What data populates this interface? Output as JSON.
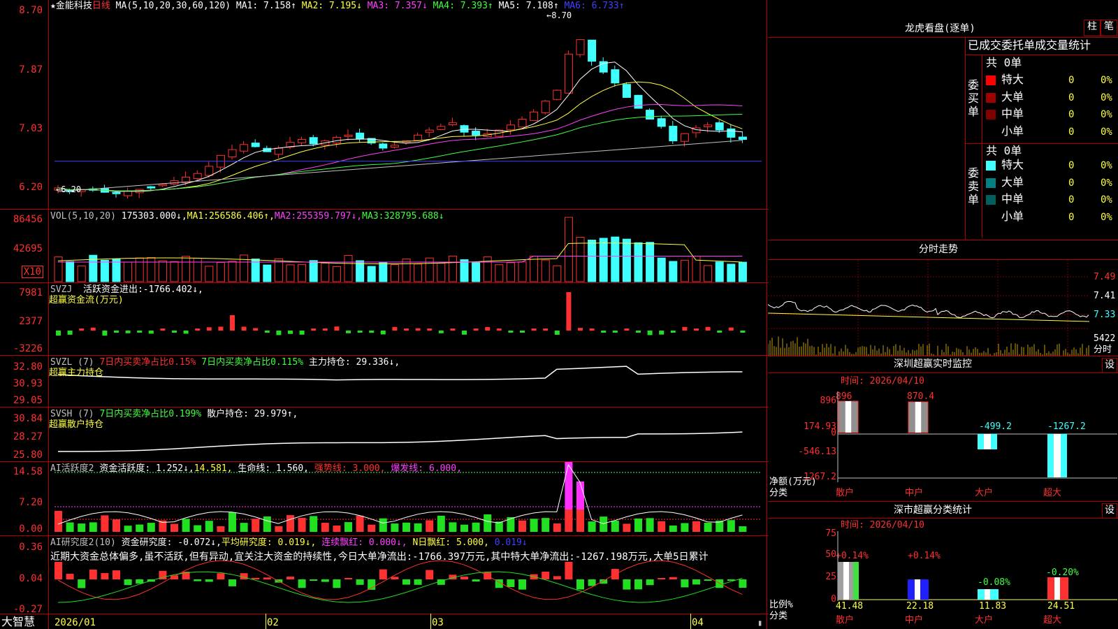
{
  "main_chart": {
    "title": "★金能科技",
    "period": "日线",
    "ma_params": "MA(5,10,20,30,60,120)",
    "ma_values": [
      {
        "label": "MA1:",
        "value": "7.158↑",
        "color": "#ffffff"
      },
      {
        "label": "MA2:",
        "value": "7.195↓",
        "color": "#ffff40"
      },
      {
        "label": "MA3:",
        "value": "7.357↓",
        "color": "#ff40ff"
      },
      {
        "label": "MA4:",
        "value": "7.393↑",
        "color": "#40ff40"
      },
      {
        "label": "MA5:",
        "value": "7.108↑",
        "color": "#ffffff"
      },
      {
        "label": "MA6:",
        "value": "6.733↑",
        "color": "#4040ff"
      }
    ],
    "y_ticks": [
      "8.70",
      "7.87",
      "7.03",
      "6.20"
    ],
    "high_label": "8.70",
    "low_label": "6.20"
  },
  "volume": {
    "params": "VOL(5,10,20)",
    "value": "175303.000↓,",
    "ma1": "256586.406↑,",
    "ma2": "255359.797↓,",
    "ma3": "328795.688↓",
    "y_ticks": [
      "86456",
      "42695"
    ],
    "unit": "X10"
  },
  "svzj": {
    "label": "SVZJ",
    "active_flow": "活跃资金进出:-1766.402↓,",
    "subtitle": "超赢资金流(万元)",
    "y_ticks": [
      "7981",
      "2377",
      "-3226"
    ]
  },
  "svzl": {
    "label": "SVZL (7)",
    "text1": "7日内买卖净占比0.15%",
    "text2": "7日内买卖净占比0.115%",
    "holding": "主力持仓: 29.336↓,",
    "subtitle": "超赢主力持仓",
    "y_ticks": [
      "32.80",
      "30.93",
      "29.05"
    ]
  },
  "svsh": {
    "label": "SVSH (7)",
    "text1": "7日内买卖净占比0.199%",
    "holding": "散户持仓: 29.979↑,",
    "subtitle": "超赢散户持仓",
    "y_ticks": [
      "30.84",
      "28.27",
      "25.80"
    ]
  },
  "ai_active": {
    "label": "AI活跃度2",
    "fund_active": "资金活跃度: 1.252↓,",
    "v2": "14.581,",
    "life": "生命线: 1.560,",
    "strong": "强势线: 3.000,",
    "burst": "爆发线: 6.000,",
    "y_ticks": [
      "14.58",
      "7.20",
      "0.00"
    ]
  },
  "ai_research": {
    "label": "AI研究度2(10)",
    "fund_research": "资金研究度: -0.072↓,",
    "avg": "平均研究度: 0.019↓,",
    "lianxu": "连续飘红: 0.000↓,",
    "nday": "N日飘红: 5.000,",
    "last": "0.019↓",
    "comment": "近期大资金总体偏多,虽不活跃,但有异动,宜关注大资金的持续性,今日大单净流出:-1766.397万元,其中特大单净流出:-1267.198万元,大单5日累计",
    "y_ticks": [
      "0.36",
      "0.04",
      "-0.27"
    ]
  },
  "x_axis": {
    "brand": "大智慧",
    "labels": [
      "2026/01",
      "02",
      "03",
      "04"
    ]
  },
  "right_panel": {
    "longhu_title": "龙虎看盘(逐单)",
    "btn_zhu": "柱",
    "btn_bi": "笔",
    "stat_title": "已成交委托单成交量统计",
    "buy": {
      "side": "委买单",
      "total": "共 0单",
      "rows": [
        {
          "name": "特大",
          "count": "0",
          "pct": "0%",
          "color": "#ff0000"
        },
        {
          "name": "大单",
          "count": "0",
          "pct": "0%",
          "color": "#a00000"
        },
        {
          "name": "中单",
          "count": "0",
          "pct": "0%",
          "color": "#800000"
        },
        {
          "name": "小单",
          "count": "0",
          "pct": "0%",
          "color": "#000000"
        }
      ]
    },
    "sell": {
      "side": "委卖单",
      "total": "共 0单",
      "rows": [
        {
          "name": "特大",
          "count": "0",
          "pct": "0%",
          "color": "#40ffff"
        },
        {
          "name": "大单",
          "count": "0",
          "pct": "0%",
          "color": "#008080"
        },
        {
          "name": "中单",
          "count": "0",
          "pct": "0%",
          "color": "#006060"
        },
        {
          "name": "小单",
          "count": "0",
          "pct": "0%",
          "color": "#000000"
        }
      ]
    },
    "timeshare": {
      "title": "分时走势",
      "y_ticks": [
        "7.49",
        "7.41",
        "7.33"
      ],
      "vol_label": "5422",
      "vol_unit": "分时"
    },
    "sz_monitor": {
      "title": "深圳超赢实时监控",
      "btn": "设",
      "time": "时间: 2026/04/10",
      "y_ticks": [
        "896",
        "174.93",
        "0",
        "-546.13",
        "-1267.2"
      ],
      "unit_label": "净额(万元)",
      "cat_label": "分类",
      "categories": [
        "散户",
        "中户",
        "大户",
        "超大"
      ],
      "values": [
        "896",
        "870.4",
        "-499.2",
        "-1267.2"
      ]
    },
    "sz_class": {
      "title": "深市超赢分类统计",
      "btn": "设",
      "time": "时间: 2026/04/10",
      "y_ticks": [
        "75",
        "50",
        "25",
        "0"
      ],
      "unit_label": "比例%",
      "cat_label": "分类",
      "categories": [
        "散户",
        "中户",
        "大户",
        "超大"
      ],
      "pct_labels": [
        "+0.14%",
        "+0.14%",
        "-0.08%",
        "-0.20%"
      ],
      "values": [
        "41.48",
        "22.18",
        "11.83",
        "24.51"
      ]
    }
  }
}
